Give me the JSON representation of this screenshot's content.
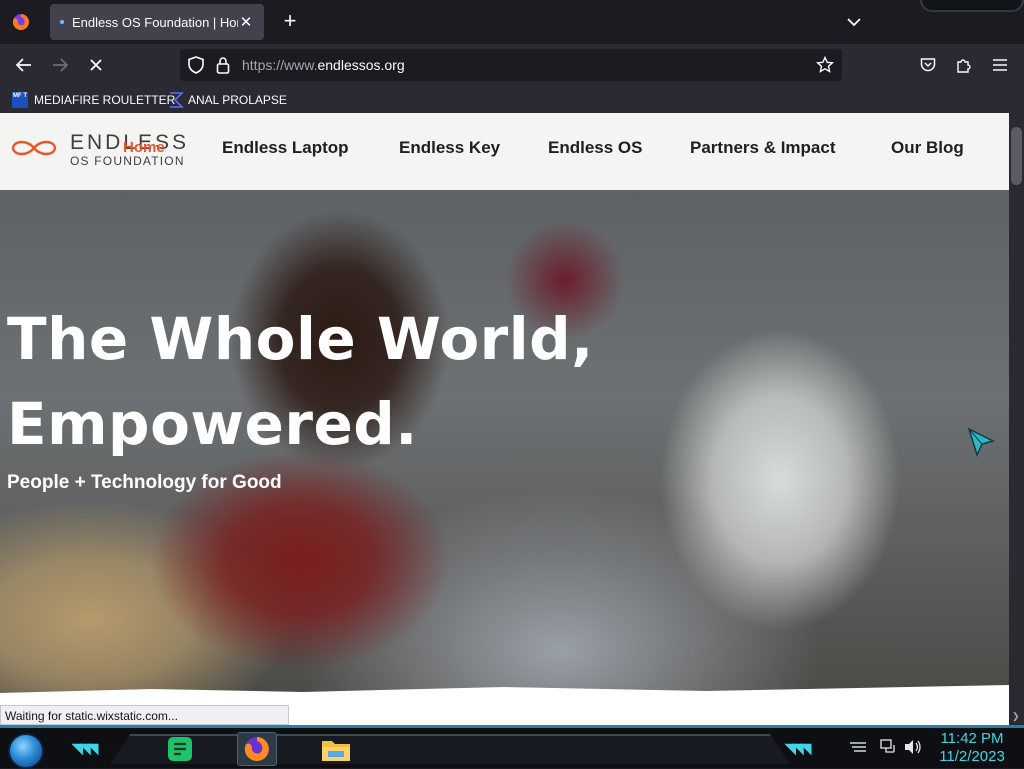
{
  "browser": {
    "tab": {
      "title": "Endless OS Foundation | Home"
    },
    "url": {
      "prefix": "https://www.",
      "domain": "endlessos.org"
    },
    "bookmarks": [
      {
        "label": "MEDIAFIRE ROULETTER",
        "icon": "mediafire-icon",
        "icon_text": "MF T"
      },
      {
        "label": "ANAL PROLAPSE",
        "icon": "sigma-icon"
      }
    ],
    "status": "Waiting for static.wixstatic.com..."
  },
  "site": {
    "logo": {
      "word": "ENDLESS",
      "sub": "OS FOUNDATION",
      "overlap_link": "Home"
    },
    "nav": [
      {
        "label": "Endless Laptop"
      },
      {
        "label": "Endless Key"
      },
      {
        "label": "Endless OS"
      },
      {
        "label": "Partners & Impact"
      },
      {
        "label": "Our Blog"
      }
    ],
    "hero": {
      "line1": "The Whole World,",
      "line2": "Empowered.",
      "subtitle": "People + Technology for Good"
    }
  },
  "taskbar": {
    "apps": [
      {
        "name": "notes-app-icon"
      },
      {
        "name": "firefox-icon",
        "active": true
      },
      {
        "name": "file-explorer-icon"
      }
    ],
    "clock": {
      "time": "11:42 PM",
      "date": "11/2/2023"
    }
  },
  "colors": {
    "accent_orange": "#e8572c",
    "taskbar_cyan": "#3fd5e6",
    "browser_dark": "#1c1b22",
    "toolbar": "#2b2a33"
  }
}
